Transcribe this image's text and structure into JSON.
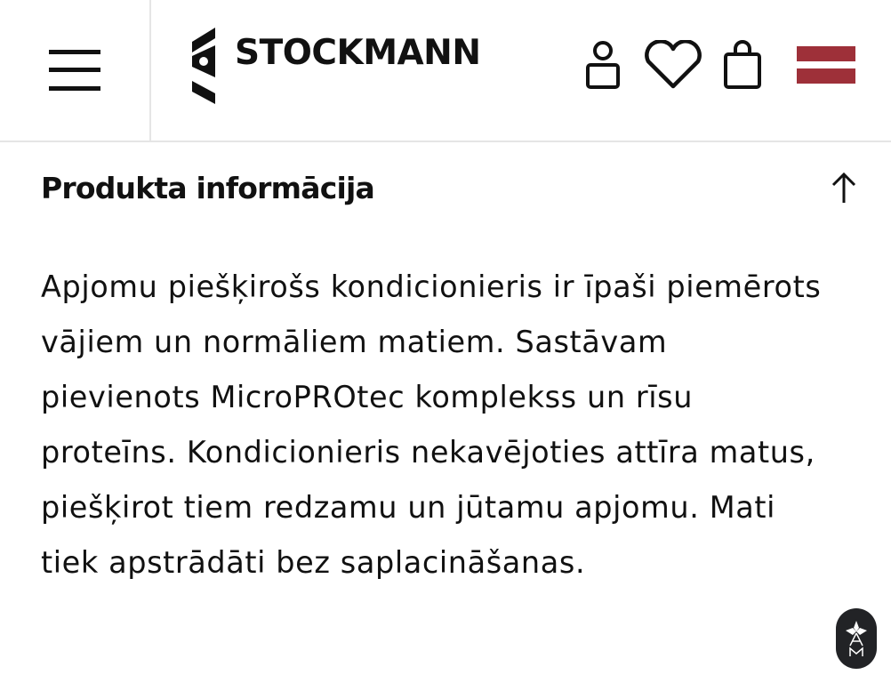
{
  "header": {
    "logo_text": "STOCKMANN",
    "icons": {
      "menu": "hamburger-menu-icon",
      "account": "user-icon",
      "wishlist": "heart-icon",
      "bag": "shopping-bag-icon",
      "language": "latvia-flag-icon"
    },
    "colors": {
      "flag_red": "#9e3039",
      "flag_white": "#ffffff"
    }
  },
  "product_info": {
    "title": "Produkta informācija",
    "collapse_icon": "arrow-up-icon",
    "description": "Apjomu piešķirošs kondicionieris ir īpaši piemērots vājiem un normāliem matiem. Sastāvam pievienots MicroPROtec komplekss un rīsu proteīns. Kondicionieris nekavējoties attīra matus, piešķirot tiem redzamu un jūtamu apjomu. Mati tiek apstrādāti bez saplacināšanas."
  },
  "floating_badge": {
    "icon": "accessibility-widget-icon"
  }
}
